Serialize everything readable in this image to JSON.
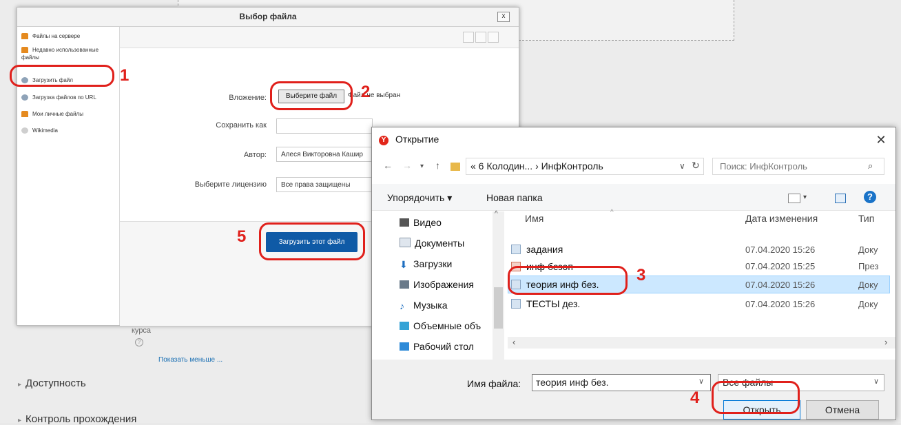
{
  "background": {
    "course_label": "курса",
    "show_less": "Показать меньше ...",
    "availability": "Доступность",
    "completion": "Контроль прохождения"
  },
  "file_picker": {
    "title": "Выбор файла",
    "close": "x",
    "sidebar": [
      {
        "label": "Файлы на сервере",
        "icon": "moodle-icon"
      },
      {
        "label": "Недавно использованные файлы",
        "icon": "moodle-icon"
      },
      {
        "label": "Загрузить файл",
        "icon": "upload-icon"
      },
      {
        "label": "Загрузка файлов по URL",
        "icon": "upload-icon"
      },
      {
        "label": "Мои личные файлы",
        "icon": "moodle-icon"
      },
      {
        "label": "Wikimedia",
        "icon": "globe-icon"
      }
    ],
    "form": {
      "attachment_label": "Вложение:",
      "choose_button": "Выберите файл",
      "no_file": "Файл не выбран",
      "save_as_label": "Сохранить как",
      "save_as_value": "",
      "author_label": "Автор:",
      "author_value": "Алеся Викторовна Кашир",
      "license_label": "Выберите лицензию",
      "license_value": "Все права защищены"
    },
    "upload_button": "Загрузить этот файл"
  },
  "open_dialog": {
    "title": "Открытие",
    "address": "« 6 Колодин... › ИнфКонтроль",
    "search_placeholder": "Поиск: ИнфКонтроль",
    "organize": "Упорядочить ▾",
    "new_folder": "Новая папка",
    "tree": [
      "Видео",
      "Документы",
      "Загрузки",
      "Изображения",
      "Музыка",
      "Объемные объ",
      "Рабочий стол"
    ],
    "columns": {
      "name": "Имя",
      "date": "Дата изменения",
      "type": "Тип"
    },
    "files": [
      {
        "name": "задания",
        "date": "07.04.2020 15:26",
        "type": "Доку"
      },
      {
        "name": "инф безоп",
        "date": "07.04.2020 15:25",
        "type": "През"
      },
      {
        "name": "теория инф без.",
        "date": "07.04.2020 15:26",
        "type": "Доку"
      },
      {
        "name": "ТЕСТЫ дез.",
        "date": "07.04.2020 15:26",
        "type": "Доку"
      }
    ],
    "filename_label": "Имя файла:",
    "filename_value": "теория инф без.",
    "filter": "Все файлы",
    "open_button": "Открыть",
    "cancel_button": "Отмена"
  },
  "annotations": [
    "1",
    "2",
    "3",
    "4",
    "5"
  ]
}
